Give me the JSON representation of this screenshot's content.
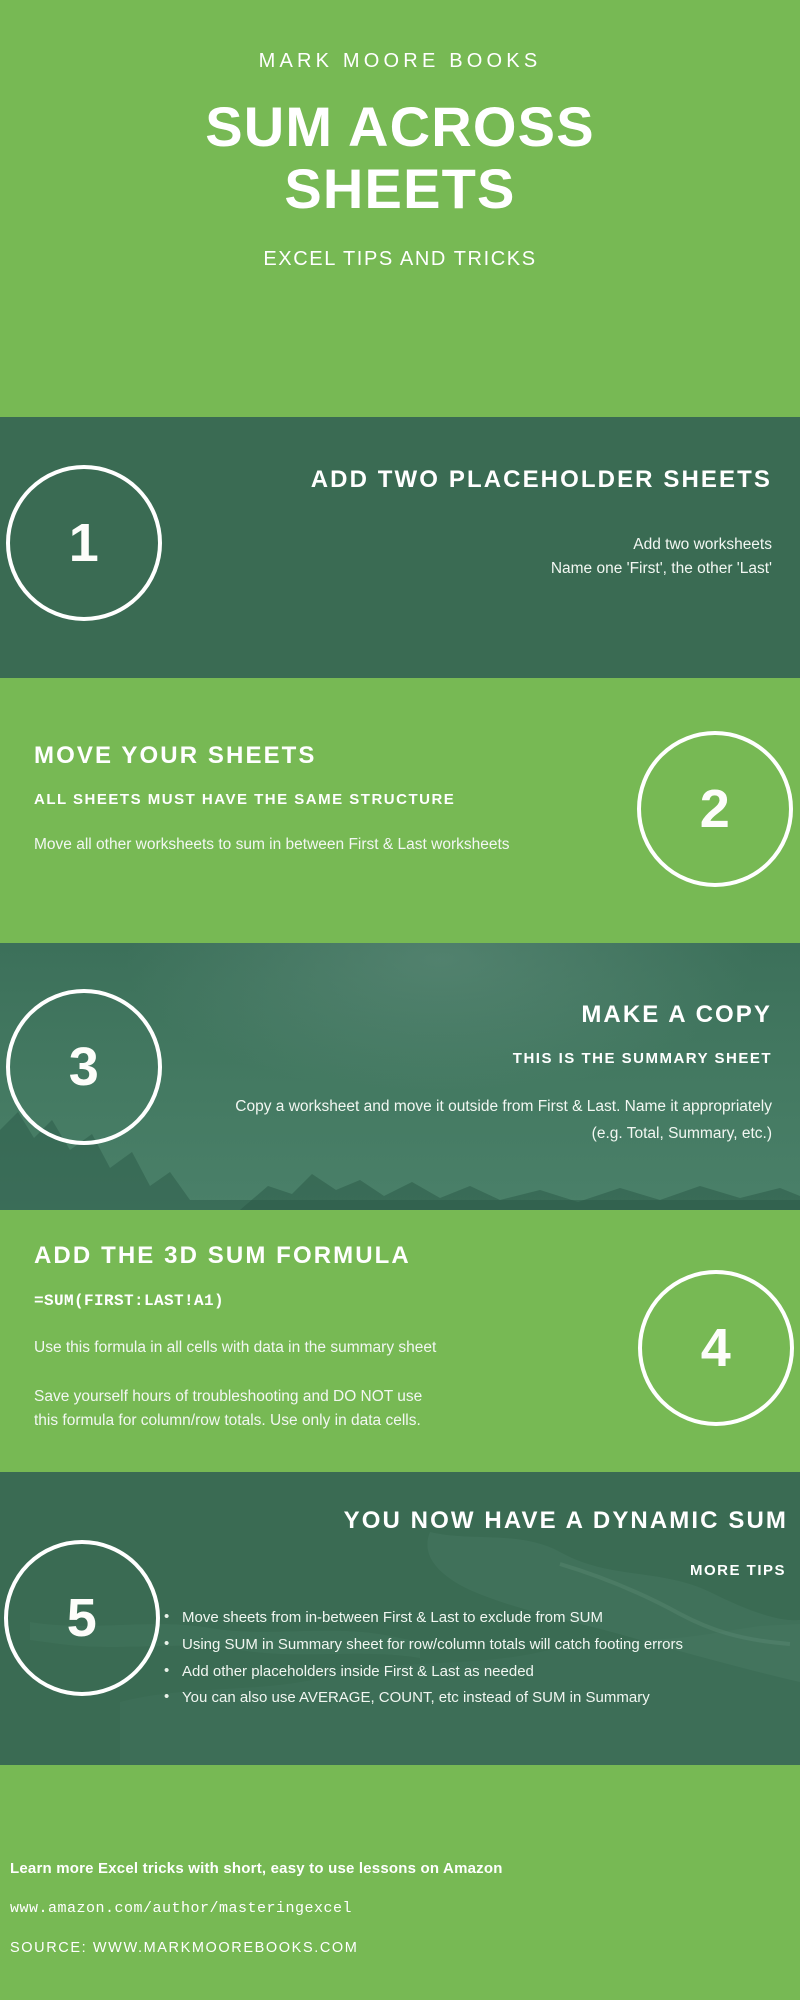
{
  "colors": {
    "brand_green": "#77b954",
    "dark_green": "#3a6b53",
    "text_white": "#ffffff"
  },
  "header": {
    "kicker": "MARK MOORE BOOKS",
    "title_line1": "SUM ACROSS",
    "title_line2": "SHEETS",
    "subtitle": "EXCEL TIPS AND TRICKS"
  },
  "steps": [
    {
      "number": "1",
      "title": "ADD TWO PLACEHOLDER SHEETS",
      "subtitle": "",
      "body_lines": [
        "Add two worksheets",
        "Name one 'First', the other 'Last'"
      ]
    },
    {
      "number": "2",
      "title": "MOVE YOUR SHEETS",
      "subtitle": "ALL SHEETS MUST HAVE THE SAME STRUCTURE",
      "body_lines": [
        "Move all other worksheets to sum in between First & Last worksheets"
      ]
    },
    {
      "number": "3",
      "title": "MAKE A COPY",
      "subtitle": "THIS IS THE SUMMARY SHEET",
      "body_lines": [
        "Copy a worksheet and move it outside from First & Last. Name it appropriately (e.g. Total, Summary, etc.)"
      ]
    },
    {
      "number": "4",
      "title": "ADD THE 3D SUM FORMULA",
      "formula": "=SUM(FIRST:LAST!A1)",
      "body_lines": [
        "Use this formula in all cells with data in the summary sheet",
        "Save yourself hours of troubleshooting and DO NOT use this formula for column/row totals. Use only in data cells."
      ]
    },
    {
      "number": "5",
      "title": "YOU NOW HAVE A DYNAMIC SUM",
      "subtitle": "MORE TIPS",
      "tips": [
        "Move sheets from in-between First & Last to exclude from SUM",
        "Using SUM in Summary sheet for row/column totals will catch footing errors",
        "Add other placeholders inside First & Last as needed",
        "You can also use AVERAGE, COUNT, etc instead of SUM in Summary"
      ]
    }
  ],
  "footer": {
    "cta": "Learn more Excel tricks with short, easy to use lessons on Amazon",
    "url": "www.amazon.com/author/masteringexcel",
    "source": "SOURCE: WWW.MARKMOOREBOOKS.COM"
  }
}
